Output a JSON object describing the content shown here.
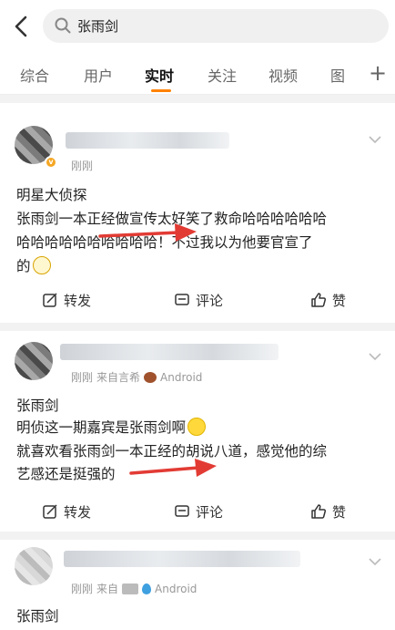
{
  "search": {
    "query": "张雨剑"
  },
  "tabs": [
    {
      "label": "综合"
    },
    {
      "label": "用户"
    },
    {
      "label": "实时",
      "active": true
    },
    {
      "label": "关注"
    },
    {
      "label": "视频"
    },
    {
      "label": "图"
    }
  ],
  "tabs_more": "+",
  "posts": [
    {
      "time": "刚刚",
      "lines": [
        "明星大侦探",
        "张雨剑一本正经做宣传太好笑了救命哈哈哈哈哈哈",
        "哈哈哈哈哈哈哈哈哈哈！不过我以为他要官宣了",
        "的"
      ],
      "emoji": "glasses-emoji-icon",
      "actions": {
        "repost": "转发",
        "comment": "评论",
        "like": "赞"
      }
    },
    {
      "time": "刚刚",
      "source_prefix": "来自言希",
      "source": "Android",
      "lines": [
        "张雨剑",
        "明侦这一期嘉宾是张雨剑啊",
        "就喜欢看张雨剑一本正经的胡说八道，感觉他的综",
        "艺感还是挺强的"
      ],
      "emoji": "smile-emoji-icon",
      "actions": {
        "repost": "转发",
        "comment": "评论",
        "like": "赞"
      }
    },
    {
      "time": "刚刚",
      "source_prefix": "来自",
      "source": "Android",
      "lines": [
        "张雨剑"
      ]
    }
  ],
  "colors": {
    "accent": "#ff8200",
    "annotation_arrow": "#e23b34",
    "badge": "#f5a623"
  }
}
